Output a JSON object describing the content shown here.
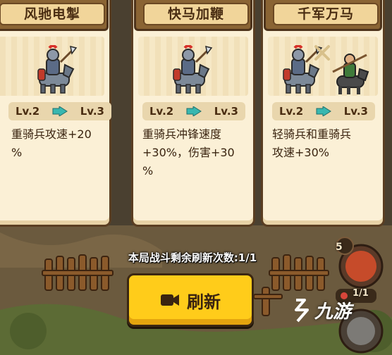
{
  "cards": [
    {
      "title": "风驰电掣",
      "from": "Lv.2",
      "to": "Lv.3",
      "desc": "重骑兵攻速+20\n%",
      "units": "heavy"
    },
    {
      "title": "快马加鞭",
      "from": "Lv.2",
      "to": "Lv.3",
      "desc": "重骑兵冲锋速度\n+30%，伤害+30\n%",
      "units": "heavy"
    },
    {
      "title": "千军万马",
      "from": "Lv.2",
      "to": "Lv.3",
      "desc": "轻骑兵和重骑兵\n攻速+30%",
      "units": "both"
    }
  ],
  "refresh": {
    "remaining_label": "本局战斗剩余刷新次数:1/1",
    "button_label": "刷新"
  },
  "side": {
    "count_top": "5",
    "count_unit": "1/1"
  },
  "watermark": {
    "text": "九游"
  },
  "colors": {
    "button": "#ffcc1a",
    "card": "#fbf0d6",
    "header": "#8a6434",
    "arrow": "#38b7b0"
  }
}
